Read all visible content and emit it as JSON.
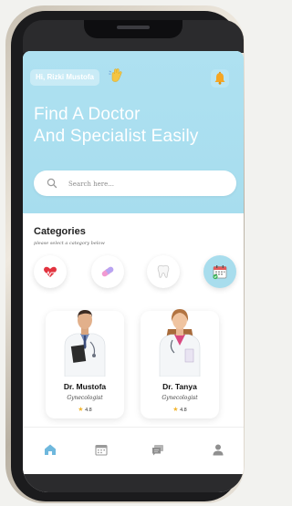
{
  "header": {
    "greeting": "Hi, Rizki Mustofa",
    "title_line1": "Find A Doctor",
    "title_line2": "And Specialist Easily"
  },
  "search": {
    "placeholder": "Search here..."
  },
  "categories": {
    "title": "Categories",
    "subtitle": "please select a category below",
    "items": [
      {
        "icon": "heart-icon",
        "active": false
      },
      {
        "icon": "pill-icon",
        "active": false
      },
      {
        "icon": "tooth-icon",
        "active": false
      },
      {
        "icon": "calendar-icon",
        "active": true
      }
    ]
  },
  "doctors": [
    {
      "name": "Dr. Mustofa",
      "specialty": "Gynecologist",
      "rating": "4.8"
    },
    {
      "name": "Dr. Tanya",
      "specialty": "Gynecologist",
      "rating": "4.8"
    }
  ],
  "nav": {
    "active": "home"
  },
  "colors": {
    "accent": "#a8dded",
    "star": "#f2b632",
    "bell": "#f5a623"
  }
}
